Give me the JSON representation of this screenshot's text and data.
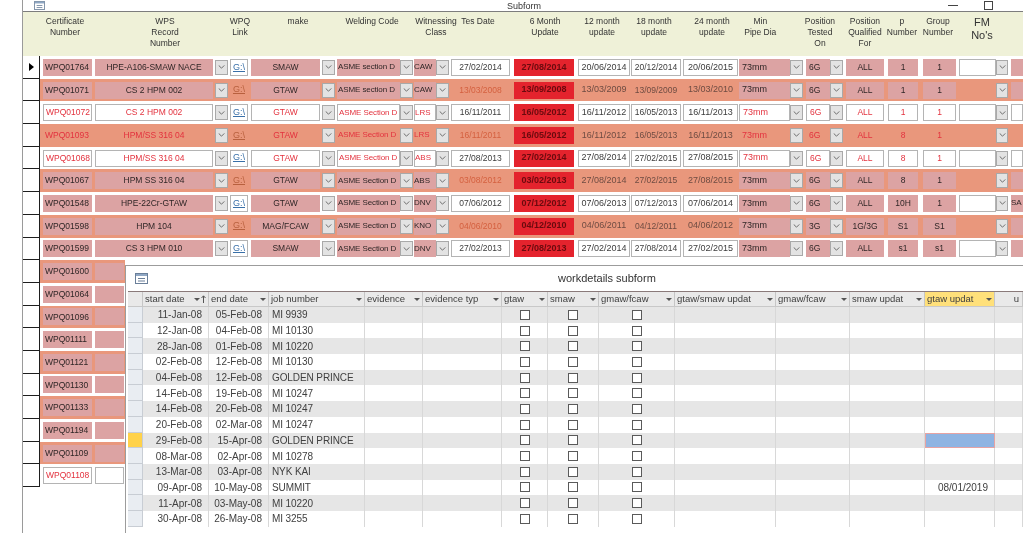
{
  "window": {
    "title": "Subform"
  },
  "form": {
    "columns": [
      "Certificate Number",
      "WPS Record Number",
      "WPQ Link",
      "make",
      "Welding Code",
      "Witnessing Class",
      "Tes Date",
      "6 Month Update",
      "12 month update",
      "18 month update",
      "24 month update",
      "Min Pipe Dia",
      "Position Tested On",
      "Position Qualified For",
      "p Number",
      "Group Number",
      "FM No's"
    ],
    "rows": [
      {
        "selected": true,
        "flagged": false,
        "certificate_number": "WPQ01764",
        "wps_record_number": "HPE-A106-SMAW NACE",
        "wpq_link": "G:\\",
        "make": "SMAW",
        "welding_code": "ASME section D",
        "witnessing_class": "CAW",
        "tes_date": "27/02/2014",
        "month_6_update": "27/08/2014",
        "month_12_update": "20/06/2014",
        "month_18_update": "20/12/2014",
        "month_24_update": "20/06/2015",
        "min_pipe_dia": "73mm",
        "position_tested_on": "6G",
        "position_qualified_for": "ALL",
        "p_number": "1",
        "group_number": "1"
      },
      {
        "selected": false,
        "flagged": false,
        "certificate_number": "WPQ01071",
        "wps_record_number": "CS 2 HPM 002",
        "wpq_link": "G:\\",
        "make": "GTAW",
        "welding_code": "ASME section D",
        "witnessing_class": "CAW",
        "tes_date": "13/03/2008",
        "month_6_update": "13/09/2008",
        "month_12_update": "13/03/2009",
        "month_18_update": "13/09/2009",
        "month_24_update": "13/03/2010",
        "min_pipe_dia": "73mm",
        "position_tested_on": "6G",
        "position_qualified_for": "ALL",
        "p_number": "1",
        "group_number": "1"
      },
      {
        "selected": false,
        "flagged": true,
        "certificate_number": "WPQ01072",
        "wps_record_number": "CS 2 HPM 002",
        "wpq_link": "G:\\",
        "make": "GTAW",
        "welding_code": "ASME Section D",
        "witnessing_class": "LRS",
        "tes_date": "16/11/2011",
        "month_6_update": "16/05/2012",
        "month_12_update": "16/11/2012",
        "month_18_update": "16/05/2013",
        "month_24_update": "16/11/2013",
        "min_pipe_dia": "73mm",
        "position_tested_on": "6G",
        "position_qualified_for": "ALL",
        "p_number": "1",
        "group_number": "1"
      },
      {
        "selected": false,
        "flagged": true,
        "certificate_number": "WPQ01093",
        "wps_record_number": "HPM/SS 316 04",
        "wpq_link": "G:\\",
        "make": "GTAW",
        "welding_code": "ASME Section D",
        "witnessing_class": "LRS",
        "tes_date": "16/11/2011",
        "month_6_update": "16/05/2012",
        "month_12_update": "16/11/2012",
        "month_18_update": "16/05/2013",
        "month_24_update": "16/11/2013",
        "min_pipe_dia": "73mm",
        "position_tested_on": "6G",
        "position_qualified_for": "ALL",
        "p_number": "8",
        "group_number": "1"
      },
      {
        "selected": false,
        "flagged": true,
        "certificate_number": "WPQ01068",
        "wps_record_number": "HPM/SS 316 04",
        "wpq_link": "G:\\",
        "make": "GTAW",
        "welding_code": "ASME Section D",
        "witnessing_class": "ABS",
        "tes_date": "27/08/2013",
        "month_6_update": "27/02/2014",
        "month_12_update": "27/08/2014",
        "month_18_update": "27/02/2015",
        "month_24_update": "27/08/2015",
        "min_pipe_dia": "73mm",
        "position_tested_on": "6G",
        "position_qualified_for": "ALL",
        "p_number": "8",
        "group_number": "1"
      },
      {
        "selected": false,
        "flagged": false,
        "certificate_number": "WPQ01067",
        "wps_record_number": "HPM SS 316 04",
        "wpq_link": "G:\\",
        "make": "GTAW",
        "welding_code": "ASME Section D",
        "witnessing_class": "ABS",
        "tes_date": "03/08/2012",
        "month_6_update": "03/02/2013",
        "month_12_update": "27/08/2014",
        "month_18_update": "27/02/2015",
        "month_24_update": "27/08/2015",
        "min_pipe_dia": "73mm",
        "position_tested_on": "6G",
        "position_qualified_for": "ALL",
        "p_number": "8",
        "group_number": "1"
      },
      {
        "selected": false,
        "flagged": false,
        "certificate_number": "WPQ01548",
        "wps_record_number": "HPE-22Cr-GTAW",
        "wpq_link": "G:\\",
        "make": "GTAW",
        "welding_code": "ASME Section D",
        "witnessing_class": "DNV",
        "tes_date": "07/06/2012",
        "month_6_update": "07/12/2012",
        "month_12_update": "07/06/2013",
        "month_18_update": "07/12/2013",
        "month_24_update": "07/06/2014",
        "min_pipe_dia": "73mm",
        "position_tested_on": "6G",
        "position_qualified_for": "ALL",
        "p_number": "10H",
        "group_number": "1",
        "column_18": "SA"
      },
      {
        "selected": false,
        "flagged": false,
        "certificate_number": "WPQ01598",
        "wps_record_number": "HPM 104",
        "wpq_link": "G:\\",
        "make": "MAG/FCAW",
        "welding_code": "ASME Section D",
        "witnessing_class": "KNO",
        "tes_date": "04/06/2010",
        "month_6_update": "04/12/2010",
        "month_12_update": "04/06/2011",
        "month_18_update": "04/12/2011",
        "month_24_update": "04/06/2012",
        "min_pipe_dia": "73mm",
        "position_tested_on": "3G",
        "position_qualified_for": "1G/3G",
        "p_number": "S1",
        "group_number": "S1"
      },
      {
        "selected": false,
        "flagged": false,
        "certificate_number": "WPQ01599",
        "wps_record_number": "CS 3 HPM 010",
        "wpq_link": "G:\\",
        "make": "SMAW",
        "welding_code": "ASME Section D",
        "witnessing_class": "DNV",
        "tes_date": "27/02/2013",
        "month_6_update": "27/08/2013",
        "month_12_update": "27/02/2014",
        "month_18_update": "27/08/2014",
        "month_24_update": "27/02/2015",
        "min_pipe_dia": "73mm",
        "position_tested_on": "6G",
        "position_qualified_for": "ALL",
        "p_number": "s1",
        "group_number": "s1"
      },
      {
        "selected": false,
        "flagged": false,
        "certificate_number": "WPQ01600"
      },
      {
        "selected": false,
        "flagged": false,
        "certificate_number": "WPQ01064"
      },
      {
        "selected": false,
        "flagged": false,
        "certificate_number": "WPQ01096"
      },
      {
        "selected": false,
        "flagged": false,
        "certificate_number": "WPQ01111"
      },
      {
        "selected": false,
        "flagged": false,
        "certificate_number": "WPQ01121"
      },
      {
        "selected": false,
        "flagged": false,
        "certificate_number": "WPQ01130"
      },
      {
        "selected": false,
        "flagged": false,
        "certificate_number": "WPQ01133"
      },
      {
        "selected": false,
        "flagged": false,
        "certificate_number": "WPQ01194"
      },
      {
        "selected": false,
        "flagged": false,
        "certificate_number": "WPQ01109"
      },
      {
        "selected": false,
        "flagged": true,
        "certificate_number": "WPQ01108"
      }
    ]
  },
  "subform": {
    "title": "workdetails subform",
    "columns": [
      {
        "label": "start date",
        "kind": "date",
        "selected": false,
        "sorted": true
      },
      {
        "label": "end date",
        "kind": "date",
        "selected": false,
        "sorted": false
      },
      {
        "label": "job number",
        "kind": "text",
        "selected": false,
        "sorted": false
      },
      {
        "label": "evidence",
        "kind": "text",
        "selected": false,
        "sorted": false
      },
      {
        "label": "evidence typ",
        "kind": "text",
        "selected": false,
        "sorted": false
      },
      {
        "label": "gtaw",
        "kind": "checkbox",
        "selected": false,
        "sorted": false
      },
      {
        "label": "smaw",
        "kind": "checkbox",
        "selected": false,
        "sorted": false
      },
      {
        "label": "gmaw/fcaw",
        "kind": "checkbox",
        "selected": false,
        "sorted": false
      },
      {
        "label": "gtaw/smaw updat",
        "kind": "text",
        "selected": false,
        "sorted": false
      },
      {
        "label": "gmaw/fcaw",
        "kind": "text",
        "selected": false,
        "sorted": false
      },
      {
        "label": "smaw updat",
        "kind": "text",
        "selected": false,
        "sorted": false
      },
      {
        "label": "gtaw updat",
        "kind": "date",
        "selected": true,
        "sorted": false
      },
      {
        "label": "u",
        "kind": "text",
        "selected": false,
        "sorted": false
      }
    ],
    "rows": [
      {
        "selected": false,
        "start_date": "11-Jan-08",
        "end_date": "05-Feb-08",
        "job_number": "MI 9939",
        "gtaw": false,
        "smaw": false,
        "gmaw_fcaw": false
      },
      {
        "selected": false,
        "start_date": "12-Jan-08",
        "end_date": "04-Feb-08",
        "job_number": "MI 10130",
        "gtaw": false,
        "smaw": false,
        "gmaw_fcaw": false
      },
      {
        "selected": false,
        "start_date": "28-Jan-08",
        "end_date": "01-Feb-08",
        "job_number": "MI 10220",
        "gtaw": false,
        "smaw": false,
        "gmaw_fcaw": false
      },
      {
        "selected": false,
        "start_date": "02-Feb-08",
        "end_date": "12-Feb-08",
        "job_number": "MI 10130",
        "gtaw": false,
        "smaw": false,
        "gmaw_fcaw": false
      },
      {
        "selected": false,
        "start_date": "04-Feb-08",
        "end_date": "12-Feb-08",
        "job_number": "GOLDEN PRINCE",
        "gtaw": false,
        "smaw": false,
        "gmaw_fcaw": false
      },
      {
        "selected": false,
        "start_date": "14-Feb-08",
        "end_date": "19-Feb-08",
        "job_number": "MI 10247",
        "gtaw": false,
        "smaw": false,
        "gmaw_fcaw": false
      },
      {
        "selected": false,
        "start_date": "14-Feb-08",
        "end_date": "20-Feb-08",
        "job_number": "MI 10247",
        "gtaw": false,
        "smaw": false,
        "gmaw_fcaw": false
      },
      {
        "selected": false,
        "start_date": "20-Feb-08",
        "end_date": "02-Mar-08",
        "job_number": "MI 10247",
        "gtaw": false,
        "smaw": false,
        "gmaw_fcaw": false
      },
      {
        "selected": true,
        "start_date": "29-Feb-08",
        "end_date": "15-Apr-08",
        "job_number": "GOLDEN PRINCE",
        "gtaw": false,
        "smaw": false,
        "gmaw_fcaw": false
      },
      {
        "selected": false,
        "start_date": "08-Mar-08",
        "end_date": "02-Apr-08",
        "job_number": "MI 10278",
        "gtaw": false,
        "smaw": false,
        "gmaw_fcaw": false
      },
      {
        "selected": false,
        "start_date": "13-Mar-08",
        "end_date": "03-Apr-08",
        "job_number": "NYK KAI",
        "gtaw": false,
        "smaw": false,
        "gmaw_fcaw": false
      },
      {
        "selected": false,
        "start_date": "09-Apr-08",
        "end_date": "10-May-08",
        "job_number": "SUMMIT",
        "gtaw": false,
        "smaw": false,
        "gmaw_fcaw": false,
        "gtaw_update": "08/01/2019"
      },
      {
        "selected": false,
        "start_date": "11-Apr-08",
        "end_date": "03-May-08",
        "job_number": "MI 10220",
        "gtaw": false,
        "smaw": false,
        "gmaw_fcaw": false
      },
      {
        "selected": false,
        "start_date": "30-Apr-08",
        "end_date": "26-May-08",
        "job_number": "MI 3255",
        "gtaw": false,
        "smaw": false,
        "gmaw_fcaw": false
      }
    ]
  }
}
